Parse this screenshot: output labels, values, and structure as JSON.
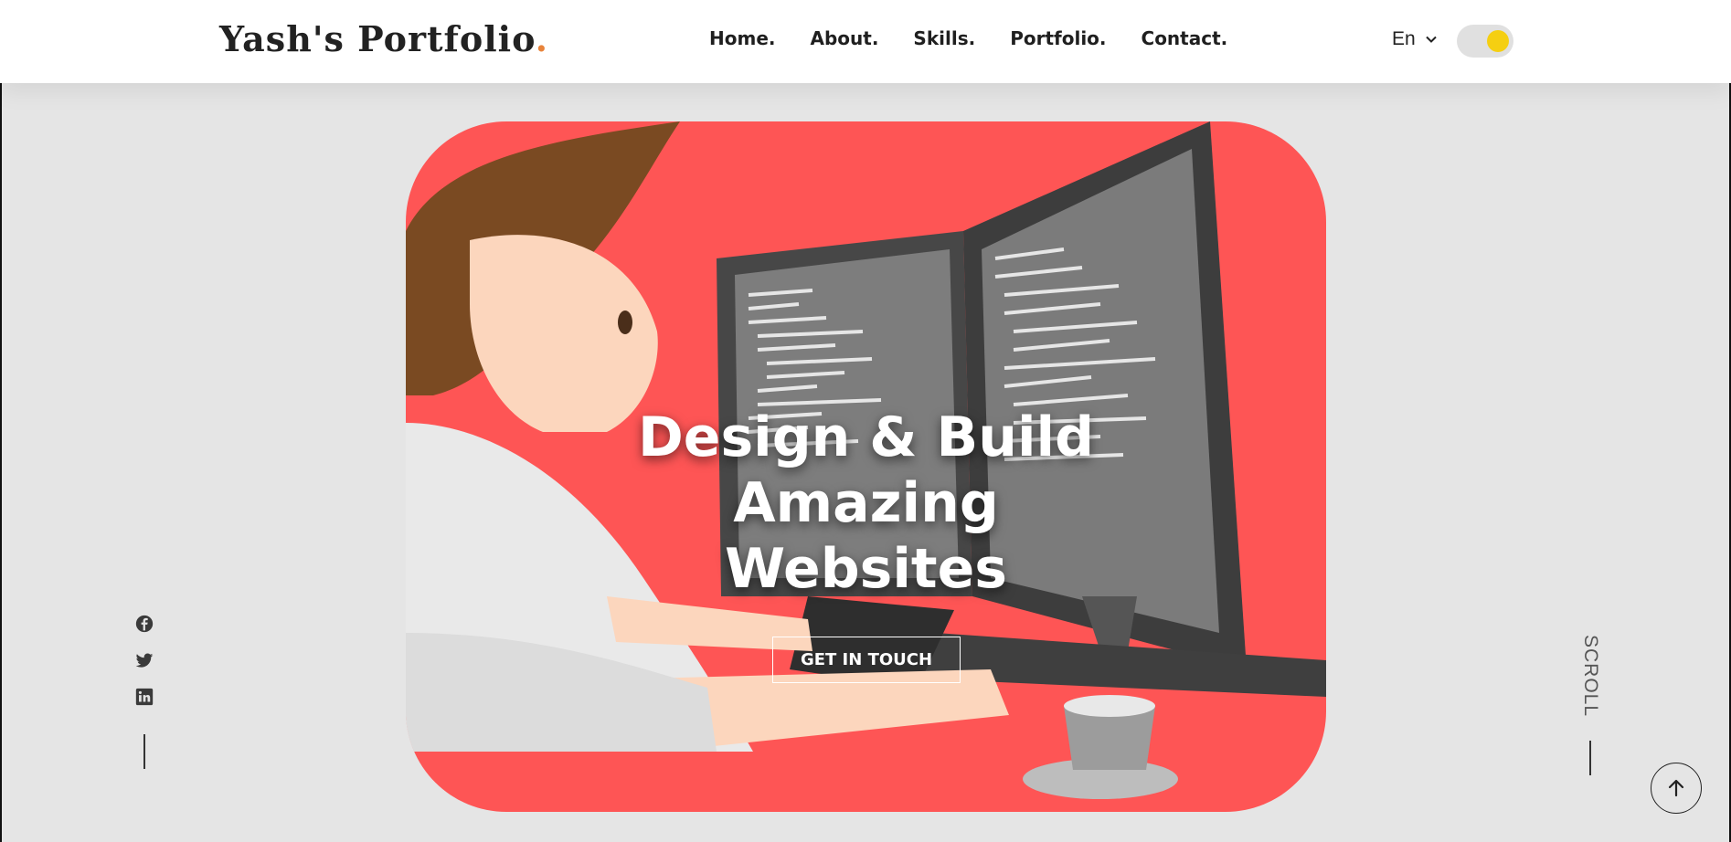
{
  "brand": {
    "name": "Yash's Portfolio",
    "dot": ".",
    "dot_color": "#e8833a"
  },
  "nav": {
    "items": [
      {
        "label": "Home."
      },
      {
        "label": "About."
      },
      {
        "label": "Skills."
      },
      {
        "label": "Portfolio."
      },
      {
        "label": "Contact."
      }
    ]
  },
  "language": {
    "selected": "En",
    "icon": "chevron-down-icon"
  },
  "theme_toggle": {
    "knob_color": "#f5cf12",
    "state": "on"
  },
  "hero": {
    "title_lines": [
      "Design & Build",
      "Amazing",
      "Websites"
    ],
    "cta_label": "GET IN TOUCH",
    "background_color": "#fe5555",
    "illustration": "developer-at-dual-monitors-illustration"
  },
  "social": {
    "icons": [
      "facebook-icon",
      "twitter-icon",
      "linkedin-icon"
    ]
  },
  "scroll": {
    "label": "SCROLL"
  },
  "back_to_top": {
    "icon": "arrow-up-icon"
  }
}
